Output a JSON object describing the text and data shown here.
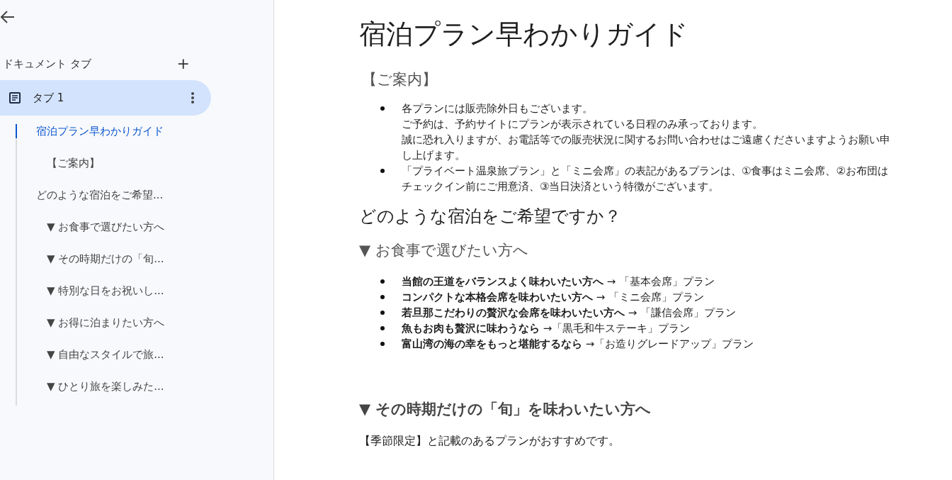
{
  "sidebar": {
    "heading": "ドキュメント タブ",
    "add_label": "+",
    "tabs": [
      {
        "label": "タブ 1",
        "selected": true
      }
    ],
    "outline": [
      {
        "label": "宿泊プラン早わかりガイド",
        "selected": true,
        "children": [
          {
            "label": "【ご案内】",
            "selected": false
          }
        ]
      },
      {
        "label": "どのような宿泊をご希望...",
        "selected": false,
        "children": [
          {
            "label": "▼ お食事で選びたい方へ",
            "selected": false
          },
          {
            "label": "▼ その時期だけの「旬...",
            "selected": false
          },
          {
            "label": "▼ 特別な日をお祝いし...",
            "selected": false
          },
          {
            "label": "▼ お得に泊まりたい方へ",
            "selected": false
          },
          {
            "label": "▼ 自由なスタイルで旅...",
            "selected": false
          },
          {
            "label": "▼ ひとり旅を楽しみた...",
            "selected": false
          }
        ]
      }
    ]
  },
  "document": {
    "blocks": [
      {
        "kind": "title",
        "text": "宿泊プラン早わかりガイド"
      },
      {
        "kind": "subtitle",
        "text": "【ご案内】"
      },
      {
        "kind": "list",
        "items": [
          {
            "lines": [
              "各プランには販売除外日もございます。",
              "ご予約は、予約サイトにプランが表示されている日程のみ承っております。",
              "誠に恐れ入りますが、お電話等での販売状況に関するお問い合わせはご遠慮くださいますようお願い申し上げます。"
            ]
          },
          {
            "lines": [
              "「プライベート温泉旅プラン」と「ミニ会席」の表記があるプランは、①食事はミニ会席、②お布団はチェックイン前にご用意済、③当日決済という特徴がございます。"
            ]
          }
        ]
      },
      {
        "kind": "heading",
        "text": "どのような宿泊をご希望ですか？"
      },
      {
        "kind": "subheading",
        "text": "▼ お食事で選びたい方へ"
      },
      {
        "kind": "list",
        "items": [
          {
            "lines": [
              "**当館の王道をバランスよく味わいたい方へ** → 「基本会席」プラン"
            ]
          },
          {
            "lines": [
              "**コンパクトな本格会席を味わいたい方へ** → 「ミニ会席」プラン"
            ]
          },
          {
            "lines": [
              "**若旦那こだわりの贅沢な会席を味わいたい方へ** → 「謙信会席」プラン"
            ]
          },
          {
            "lines": [
              "**魚もお肉も贅沢に味わうなら** →「黒毛和牛ステーキ」プラン"
            ]
          },
          {
            "lines": [
              "**富山湾の海の幸をもっと堪能するなら** →「お造りグレードアップ」プラン"
            ]
          }
        ]
      },
      {
        "kind": "bold-subheading",
        "text": "▼ その時期だけの「旬」を味わいたい方へ"
      },
      {
        "kind": "paragraph",
        "text": "【季節限定】と記載のあるプランがおすすめです。"
      }
    ]
  }
}
